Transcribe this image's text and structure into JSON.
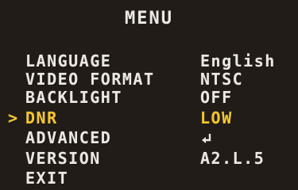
{
  "menu": {
    "title": "MENU",
    "cursor": ">",
    "items": [
      {
        "label": "LANGUAGE",
        "value": "English"
      },
      {
        "label": "VIDEO FORMAT",
        "value": "NTSC"
      },
      {
        "label": "BACKLIGHT",
        "value": "OFF"
      },
      {
        "label": "DNR",
        "value": "LOW",
        "selected": true
      },
      {
        "label": "ADVANCED",
        "icon": "enter-arrow-icon"
      },
      {
        "label": "VERSION",
        "value": "A2.L.5"
      },
      {
        "label": "EXIT"
      }
    ]
  },
  "colors": {
    "background": "#221c18",
    "text": "#ece7e2",
    "highlight": "#f4c62a"
  }
}
